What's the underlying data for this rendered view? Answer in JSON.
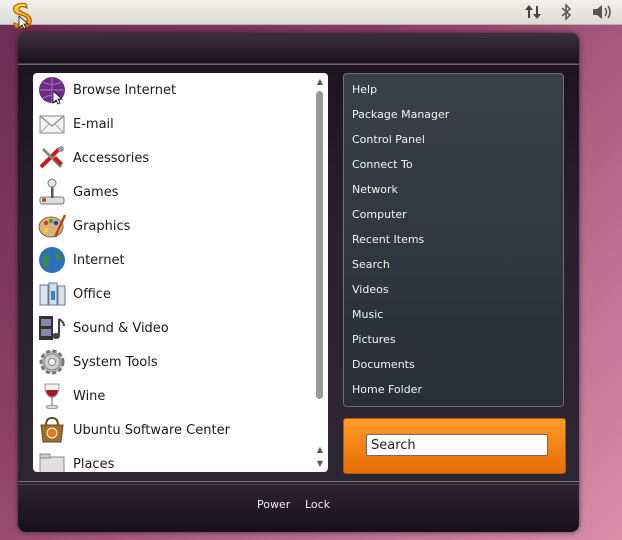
{
  "panel": {
    "tray_icons": [
      "network-updown-icon",
      "bluetooth-icon",
      "volume-icon"
    ]
  },
  "apps": {
    "items": [
      {
        "label": "Browse Internet",
        "icon": "globe-purple-icon"
      },
      {
        "label": "E-mail",
        "icon": "envelope-icon"
      },
      {
        "label": "Accessories",
        "icon": "accessories-tools-icon"
      },
      {
        "label": "Games",
        "icon": "joystick-icon"
      },
      {
        "label": "Graphics",
        "icon": "palette-icon"
      },
      {
        "label": "Internet",
        "icon": "globe-blue-icon"
      },
      {
        "label": "Office",
        "icon": "office-icon"
      },
      {
        "label": "Sound & Video",
        "icon": "film-music-icon"
      },
      {
        "label": "System Tools",
        "icon": "gear-icon"
      },
      {
        "label": "Wine",
        "icon": "wine-glass-icon"
      },
      {
        "label": "Ubuntu Software Center",
        "icon": "software-center-icon"
      },
      {
        "label": "Places",
        "icon": "places-icon"
      }
    ]
  },
  "places": {
    "items": [
      "Help",
      "Package Manager",
      "Control Panel",
      "Connect To",
      "Network",
      "Computer",
      "Recent Items",
      "Search",
      "Videos",
      "Music",
      "Pictures",
      "Documents",
      "Home Folder"
    ]
  },
  "search": {
    "value": "Search"
  },
  "footer": {
    "power_label": "Power",
    "lock_label": "Lock"
  },
  "colors": {
    "search_accent": "#f07e10",
    "panel_bg": "#2a2e35"
  }
}
